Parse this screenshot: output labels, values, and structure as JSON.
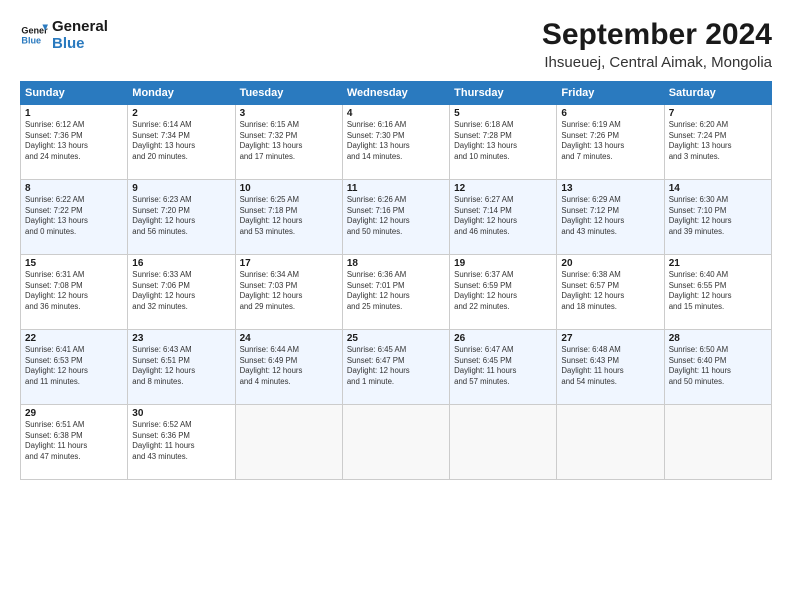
{
  "logo": {
    "line1": "General",
    "line2": "Blue"
  },
  "title": "September 2024",
  "subtitle": "Ihsueuej, Central Aimak, Mongolia",
  "days_header": [
    "Sunday",
    "Monday",
    "Tuesday",
    "Wednesday",
    "Thursday",
    "Friday",
    "Saturday"
  ],
  "weeks": [
    [
      {
        "day": "1",
        "info": "Sunrise: 6:12 AM\nSunset: 7:36 PM\nDaylight: 13 hours\nand 24 minutes."
      },
      {
        "day": "2",
        "info": "Sunrise: 6:14 AM\nSunset: 7:34 PM\nDaylight: 13 hours\nand 20 minutes."
      },
      {
        "day": "3",
        "info": "Sunrise: 6:15 AM\nSunset: 7:32 PM\nDaylight: 13 hours\nand 17 minutes."
      },
      {
        "day": "4",
        "info": "Sunrise: 6:16 AM\nSunset: 7:30 PM\nDaylight: 13 hours\nand 14 minutes."
      },
      {
        "day": "5",
        "info": "Sunrise: 6:18 AM\nSunset: 7:28 PM\nDaylight: 13 hours\nand 10 minutes."
      },
      {
        "day": "6",
        "info": "Sunrise: 6:19 AM\nSunset: 7:26 PM\nDaylight: 13 hours\nand 7 minutes."
      },
      {
        "day": "7",
        "info": "Sunrise: 6:20 AM\nSunset: 7:24 PM\nDaylight: 13 hours\nand 3 minutes."
      }
    ],
    [
      {
        "day": "8",
        "info": "Sunrise: 6:22 AM\nSunset: 7:22 PM\nDaylight: 13 hours\nand 0 minutes."
      },
      {
        "day": "9",
        "info": "Sunrise: 6:23 AM\nSunset: 7:20 PM\nDaylight: 12 hours\nand 56 minutes."
      },
      {
        "day": "10",
        "info": "Sunrise: 6:25 AM\nSunset: 7:18 PM\nDaylight: 12 hours\nand 53 minutes."
      },
      {
        "day": "11",
        "info": "Sunrise: 6:26 AM\nSunset: 7:16 PM\nDaylight: 12 hours\nand 50 minutes."
      },
      {
        "day": "12",
        "info": "Sunrise: 6:27 AM\nSunset: 7:14 PM\nDaylight: 12 hours\nand 46 minutes."
      },
      {
        "day": "13",
        "info": "Sunrise: 6:29 AM\nSunset: 7:12 PM\nDaylight: 12 hours\nand 43 minutes."
      },
      {
        "day": "14",
        "info": "Sunrise: 6:30 AM\nSunset: 7:10 PM\nDaylight: 12 hours\nand 39 minutes."
      }
    ],
    [
      {
        "day": "15",
        "info": "Sunrise: 6:31 AM\nSunset: 7:08 PM\nDaylight: 12 hours\nand 36 minutes."
      },
      {
        "day": "16",
        "info": "Sunrise: 6:33 AM\nSunset: 7:06 PM\nDaylight: 12 hours\nand 32 minutes."
      },
      {
        "day": "17",
        "info": "Sunrise: 6:34 AM\nSunset: 7:03 PM\nDaylight: 12 hours\nand 29 minutes."
      },
      {
        "day": "18",
        "info": "Sunrise: 6:36 AM\nSunset: 7:01 PM\nDaylight: 12 hours\nand 25 minutes."
      },
      {
        "day": "19",
        "info": "Sunrise: 6:37 AM\nSunset: 6:59 PM\nDaylight: 12 hours\nand 22 minutes."
      },
      {
        "day": "20",
        "info": "Sunrise: 6:38 AM\nSunset: 6:57 PM\nDaylight: 12 hours\nand 18 minutes."
      },
      {
        "day": "21",
        "info": "Sunrise: 6:40 AM\nSunset: 6:55 PM\nDaylight: 12 hours\nand 15 minutes."
      }
    ],
    [
      {
        "day": "22",
        "info": "Sunrise: 6:41 AM\nSunset: 6:53 PM\nDaylight: 12 hours\nand 11 minutes."
      },
      {
        "day": "23",
        "info": "Sunrise: 6:43 AM\nSunset: 6:51 PM\nDaylight: 12 hours\nand 8 minutes."
      },
      {
        "day": "24",
        "info": "Sunrise: 6:44 AM\nSunset: 6:49 PM\nDaylight: 12 hours\nand 4 minutes."
      },
      {
        "day": "25",
        "info": "Sunrise: 6:45 AM\nSunset: 6:47 PM\nDaylight: 12 hours\nand 1 minute."
      },
      {
        "day": "26",
        "info": "Sunrise: 6:47 AM\nSunset: 6:45 PM\nDaylight: 11 hours\nand 57 minutes."
      },
      {
        "day": "27",
        "info": "Sunrise: 6:48 AM\nSunset: 6:43 PM\nDaylight: 11 hours\nand 54 minutes."
      },
      {
        "day": "28",
        "info": "Sunrise: 6:50 AM\nSunset: 6:40 PM\nDaylight: 11 hours\nand 50 minutes."
      }
    ],
    [
      {
        "day": "29",
        "info": "Sunrise: 6:51 AM\nSunset: 6:38 PM\nDaylight: 11 hours\nand 47 minutes."
      },
      {
        "day": "30",
        "info": "Sunrise: 6:52 AM\nSunset: 6:36 PM\nDaylight: 11 hours\nand 43 minutes."
      },
      {
        "day": "",
        "info": ""
      },
      {
        "day": "",
        "info": ""
      },
      {
        "day": "",
        "info": ""
      },
      {
        "day": "",
        "info": ""
      },
      {
        "day": "",
        "info": ""
      }
    ]
  ]
}
